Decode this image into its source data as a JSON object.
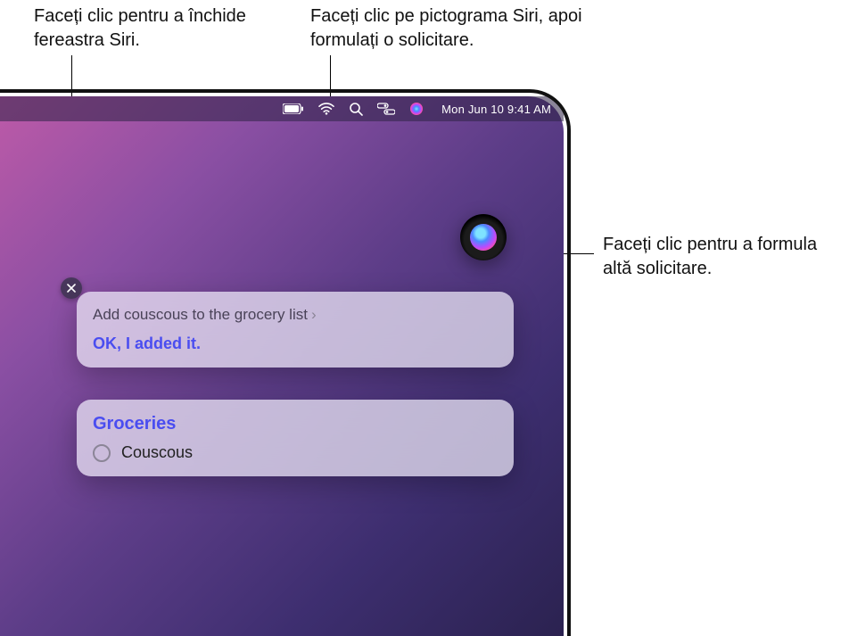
{
  "callouts": {
    "close": "Faceți clic pentru a închide fereastra Siri.",
    "menubar": "Faceți clic pe pictograma Siri, apoi formulați o solicitare.",
    "orb": "Faceți clic pentru a formula altă solicitare."
  },
  "menubar": {
    "datetime": "Mon Jun 10  9:41 AM",
    "icons": [
      "battery",
      "wifi",
      "search",
      "control-center",
      "siri"
    ]
  },
  "siri": {
    "request": "Add couscous to the grocery list",
    "confirmation": "OK, I added it.",
    "list_title": "Groceries",
    "list_items": [
      "Couscous"
    ]
  }
}
